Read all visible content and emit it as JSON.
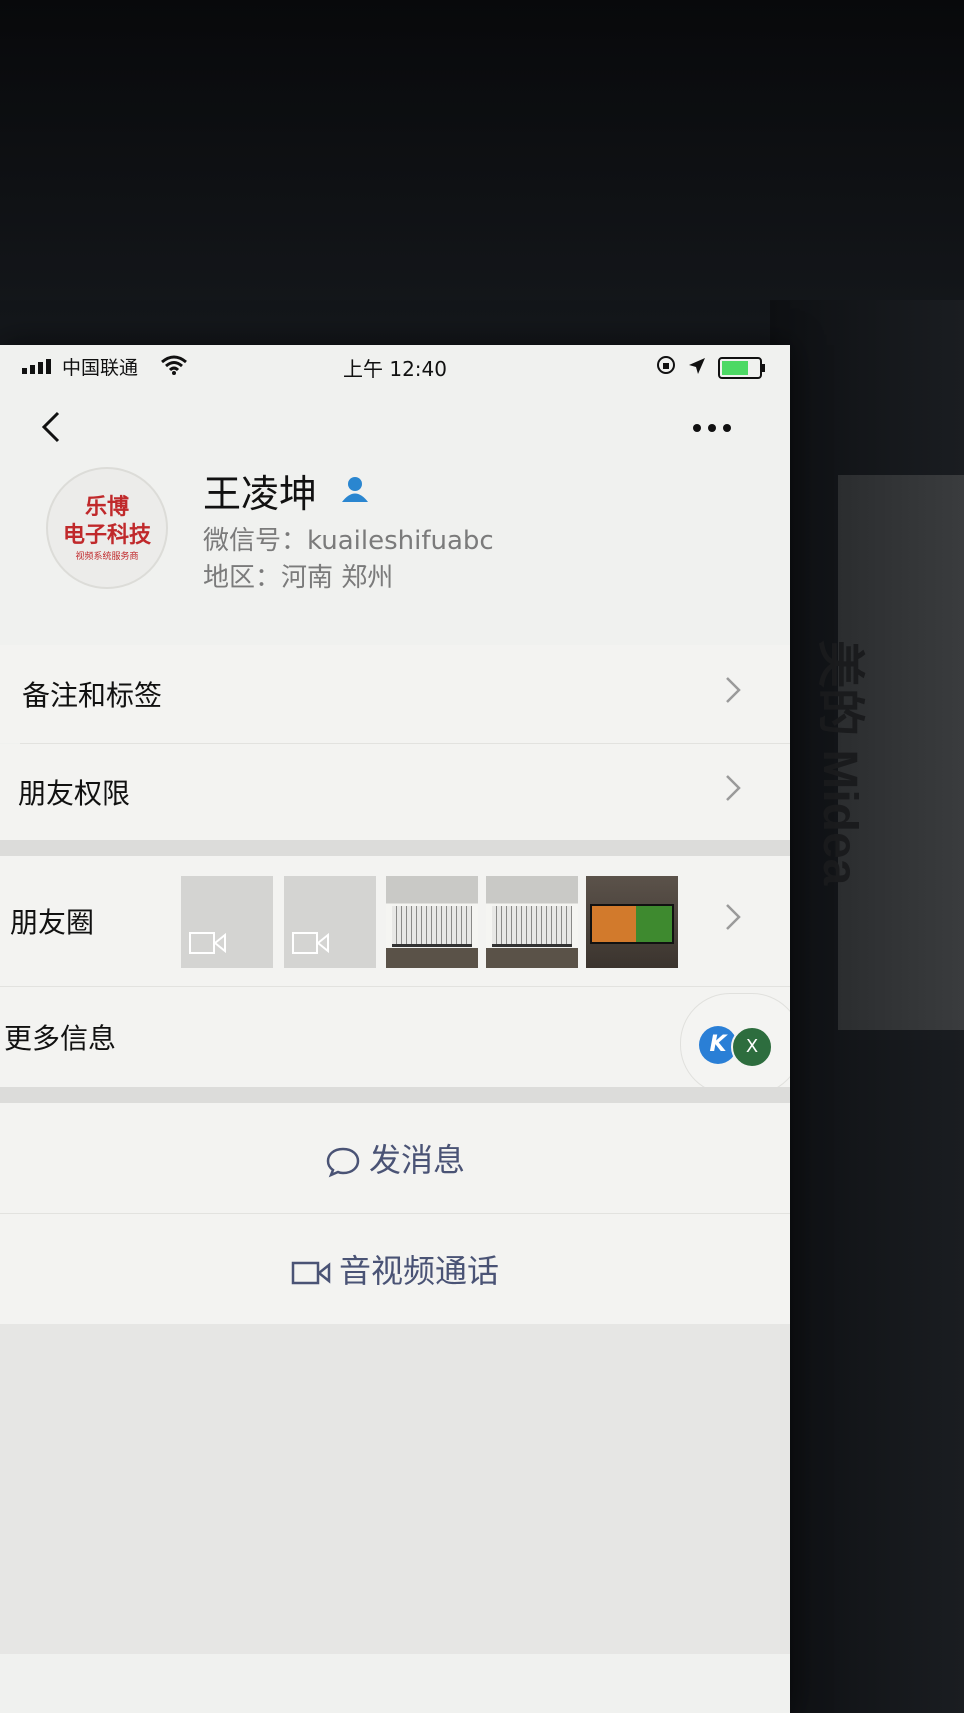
{
  "status_bar": {
    "carrier": "中国联通",
    "time": "上午 12:40",
    "battery_level": 0.8
  },
  "profile": {
    "avatar_text": {
      "line1": "乐博",
      "line2": "电子科技",
      "line3": "视频系统服务商"
    },
    "name": "王凌坤",
    "wechat_id": "微信号：kuaileshifuabc",
    "region": "地区：河南 郑州"
  },
  "menu": {
    "remarks_tags": "备注和标签",
    "friend_permissions": "朋友权限",
    "moments": "朋友圈",
    "more_info": "更多信息"
  },
  "floating": {
    "left_badge": "K",
    "close_label": "X"
  },
  "actions": {
    "send_message": "发消息",
    "video_call": "音视频通话"
  },
  "background": {
    "box_brand": "美的 Midea"
  },
  "colors": {
    "action_text": "#4a5375",
    "verify_icon": "#2a86d0",
    "battery_fill": "#4cd964",
    "avatar_red": "#c0292b"
  }
}
